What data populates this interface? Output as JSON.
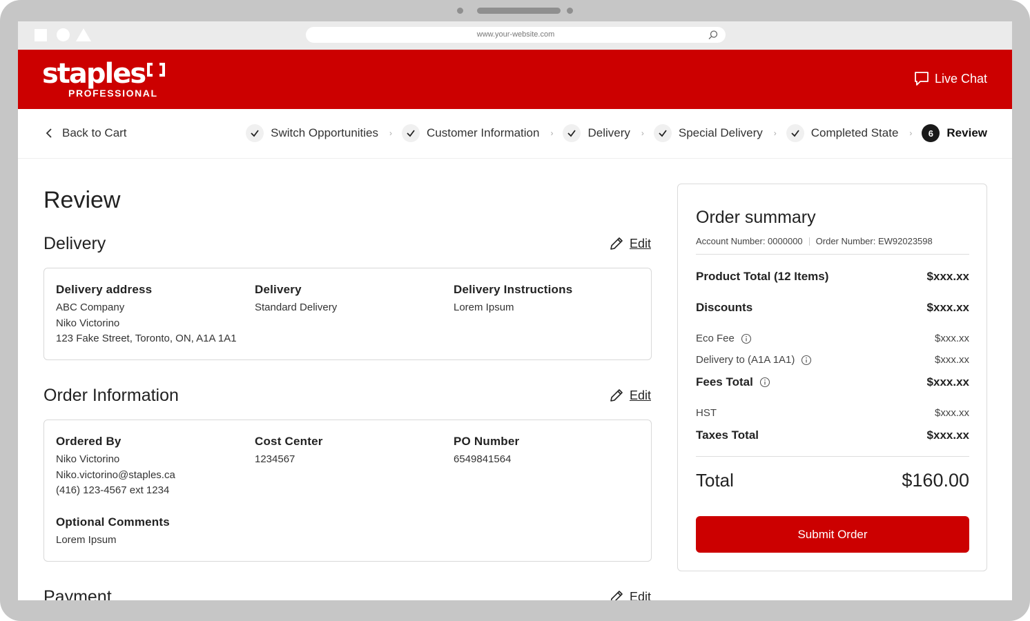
{
  "browser": {
    "url": "www.your-website.com"
  },
  "header": {
    "logo_main": "staples",
    "logo_sub": "PROFESSIONAL",
    "live_chat": "Live Chat",
    "brand_color": "#cc0000"
  },
  "stepper": {
    "back_label": "Back to Cart",
    "steps": [
      {
        "label": "Switch Opportunities",
        "state": "done"
      },
      {
        "label": "Customer Information",
        "state": "done"
      },
      {
        "label": "Delivery",
        "state": "done"
      },
      {
        "label": "Special Delivery",
        "state": "done"
      },
      {
        "label": "Completed State",
        "state": "done"
      },
      {
        "label": "Review",
        "state": "current",
        "number": "6"
      }
    ]
  },
  "main": {
    "title": "Review",
    "edit_label": "Edit",
    "delivery": {
      "title": "Delivery",
      "address_label": "Delivery address",
      "address_lines": [
        "ABC Company",
        "Niko Victorino",
        "123 Fake Street, Toronto, ON, A1A 1A1"
      ],
      "method_label": "Delivery",
      "method_value": "Standard Delivery",
      "instructions_label": "Delivery Instructions",
      "instructions_value": "Lorem Ipsum"
    },
    "order_info": {
      "title": "Order Information",
      "ordered_by_label": "Ordered By",
      "ordered_by_lines": [
        "Niko Victorino",
        "Niko.victorino@staples.ca",
        "(416) 123-4567 ext 1234"
      ],
      "cost_center_label": "Cost Center",
      "cost_center_value": "1234567",
      "po_label": "PO Number",
      "po_value": "6549841564",
      "comments_label": "Optional Comments",
      "comments_value": "Lorem Ipsum"
    },
    "payment": {
      "title": "Payment"
    }
  },
  "summary": {
    "title": "Order summary",
    "account": "Account Number: 0000000",
    "order_number": "Order Number: EW92023598",
    "product_total_label": "Product Total (12 Items)",
    "product_total_value": "$xxx.xx",
    "discounts_label": "Discounts",
    "discounts_value": "$xxx.xx",
    "eco_fee_label": "Eco Fee",
    "eco_fee_value": "$xxx.xx",
    "delivery_fee_label": "Delivery to (A1A 1A1)",
    "delivery_fee_value": "$xxx.xx",
    "fees_total_label": "Fees Total",
    "fees_total_value": "$xxx.xx",
    "hst_label": "HST",
    "hst_value": "$xxx.xx",
    "taxes_total_label": "Taxes Total",
    "taxes_total_value": "$xxx.xx",
    "total_label": "Total",
    "total_value": "$160.00",
    "submit_label": "Submit Order"
  }
}
